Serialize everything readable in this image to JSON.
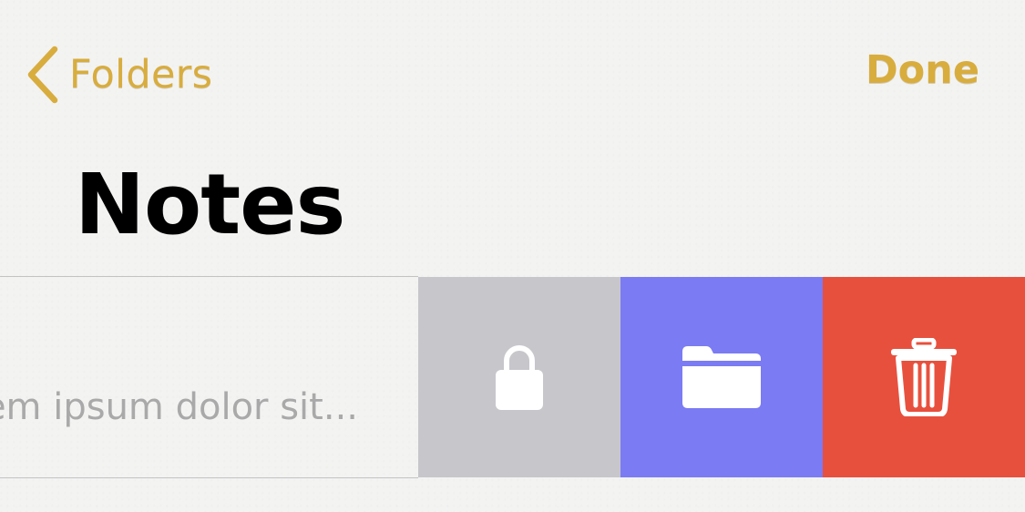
{
  "nav": {
    "back_label": "Folders",
    "done_label": "Done"
  },
  "page": {
    "title": "Notes"
  },
  "note_row": {
    "preview_text": "em ipsum dolor sit..."
  },
  "swipe_actions": [
    {
      "name": "lock",
      "icon": "lock-icon",
      "color": "#c7c6cb"
    },
    {
      "name": "move",
      "icon": "folder-icon",
      "color": "#7b7bf3"
    },
    {
      "name": "delete",
      "icon": "trash-icon",
      "color": "#e8503e"
    }
  ],
  "colors": {
    "accent": "#d8ad3e",
    "background": "#f3f3f2"
  }
}
